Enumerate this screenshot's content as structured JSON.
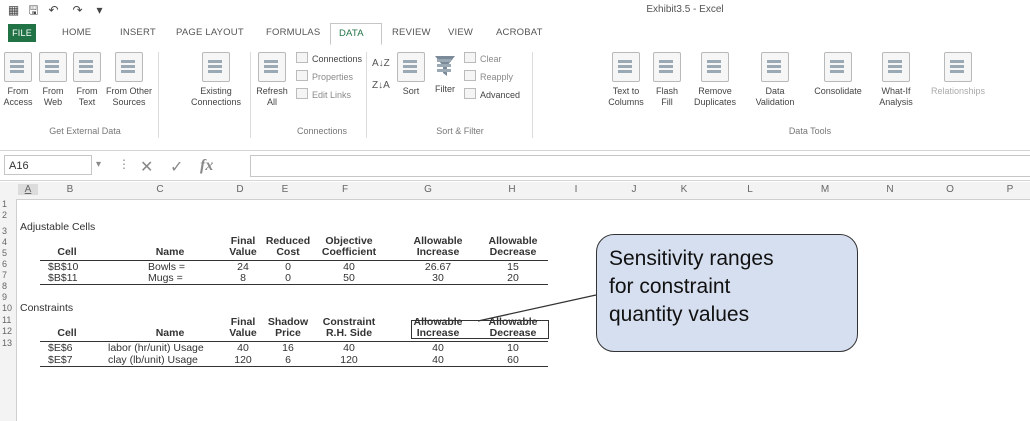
{
  "window": {
    "title": "Exhibit3.5 - Excel"
  },
  "tabs": [
    "FILE",
    "HOME",
    "INSERT",
    "PAGE LAYOUT",
    "FORMULAS",
    "DATA",
    "REVIEW",
    "VIEW",
    "ACROBAT"
  ],
  "ribbon": {
    "get_external": {
      "from_access": "From Access",
      "from_web": "From Web",
      "from_text": "From Text",
      "from_other": "From Other Sources",
      "group": "Get External Data"
    },
    "existing": "Existing Connections",
    "connections": {
      "refresh": "Refresh All",
      "connections": "Connections",
      "properties": "Properties",
      "edit_links": "Edit Links",
      "group": "Connections"
    },
    "sort_filter": {
      "sort": "Sort",
      "filter": "Filter",
      "clear": "Clear",
      "reapply": "Reapply",
      "advanced": "Advanced",
      "group": "Sort & Filter"
    },
    "data_tools": {
      "text_to_columns": "Text to Columns",
      "flash_fill": "Flash Fill",
      "remove_duplicates": "Remove Duplicates",
      "data_validation": "Data Validation",
      "consolidate": "Consolidate",
      "what_if": "What-If Analysis",
      "relationships": "Relationships",
      "group": "Data Tools"
    }
  },
  "formula_bar": {
    "name_box": "A16",
    "fx": "fx"
  },
  "columns": [
    "A",
    "B",
    "C",
    "D",
    "E",
    "F",
    "G",
    "H",
    "I",
    "J",
    "K",
    "L",
    "M",
    "N",
    "O",
    "P"
  ],
  "rows": [
    "1",
    "2",
    "3",
    "4",
    "5",
    "6",
    "7",
    "8",
    "9",
    "10",
    "11",
    "12",
    "13"
  ],
  "sheet": {
    "adjustable_title": "Adjustable Cells",
    "adj_headers": {
      "cell": "Cell",
      "name": "Name",
      "final_top": "Final",
      "final_bot": "Value",
      "reduced_top": "Reduced",
      "reduced_bot": "Cost",
      "obj_top": "Objective",
      "obj_bot": "Coefficient",
      "inc_top": "Allowable",
      "inc_bot": "Increase",
      "dec_top": "Allowable",
      "dec_bot": "Decrease"
    },
    "adj_rows": [
      {
        "cell": "$B$10",
        "name": "Bowls =",
        "final": "24",
        "reduced": "0",
        "obj": "40",
        "inc": "26.67",
        "dec": "15"
      },
      {
        "cell": "$B$11",
        "name": "Mugs =",
        "final": "8",
        "reduced": "0",
        "obj": "50",
        "inc": "30",
        "dec": "20"
      }
    ],
    "constraints_title": "Constraints",
    "con_headers": {
      "cell": "Cell",
      "name": "Name",
      "final_top": "Final",
      "final_bot": "Value",
      "shadow_top": "Shadow",
      "shadow_bot": "Price",
      "rhs_top": "Constraint",
      "rhs_bot": "R.H. Side",
      "inc_top": "Allowable",
      "inc_bot": "Increase",
      "dec_top": "Allowable",
      "dec_bot": "Decrease"
    },
    "con_rows": [
      {
        "cell": "$E$6",
        "name": "labor (hr/unit) Usage",
        "final": "40",
        "shadow": "16",
        "rhs": "40",
        "inc": "40",
        "dec": "10"
      },
      {
        "cell": "$E$7",
        "name": "clay (lb/unit) Usage",
        "final": "120",
        "shadow": "6",
        "rhs": "120",
        "inc": "40",
        "dec": "60"
      }
    ]
  },
  "callout": {
    "line1": "Sensitivity ranges",
    "line2": "for constraint",
    "line3": "quantity values"
  }
}
